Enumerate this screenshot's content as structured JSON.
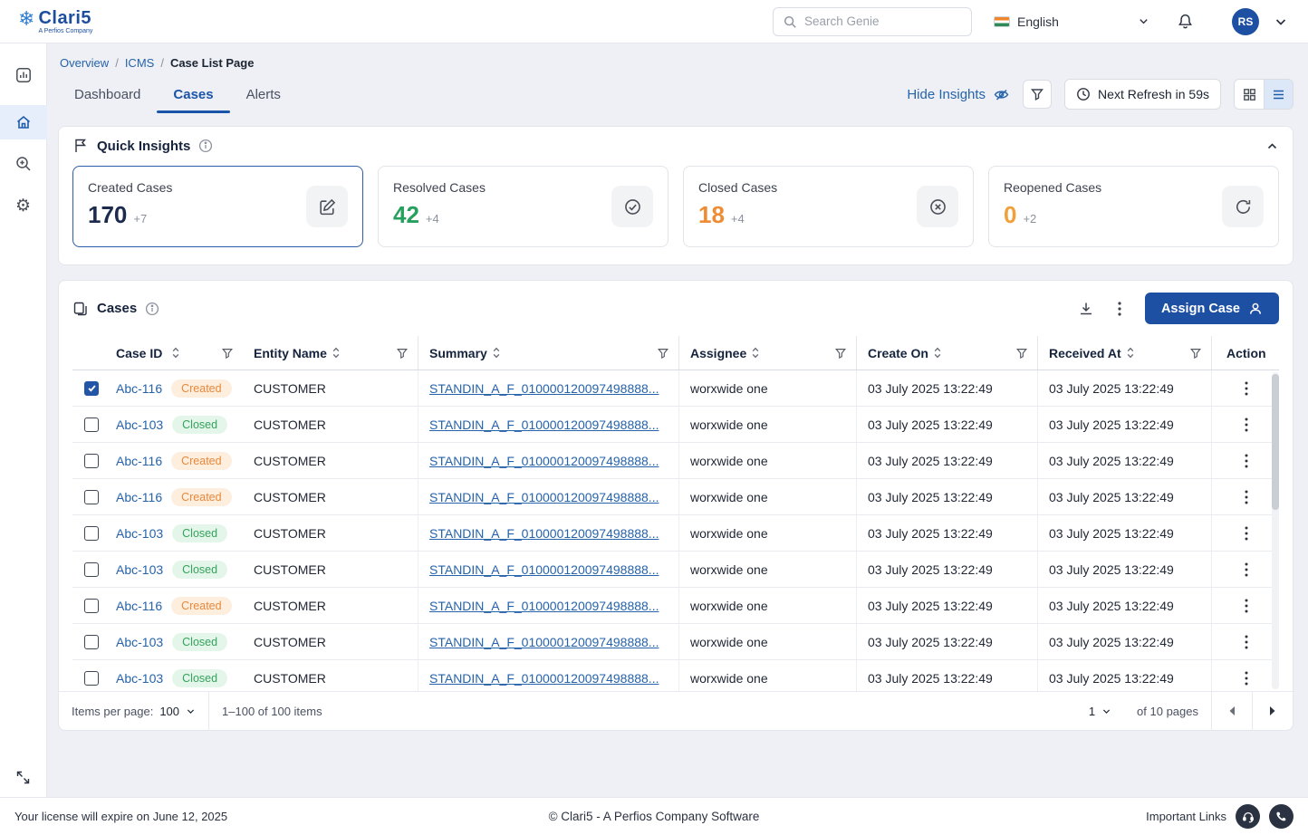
{
  "header": {
    "brand": "Clari5",
    "brand_subtitle": "A Perfios Company",
    "search_placeholder": "Search Genie",
    "language": "English",
    "avatar_initials": "RS"
  },
  "breadcrumb": {
    "overview": "Overview",
    "icms": "ICMS",
    "current": "Case List Page",
    "separator": "/"
  },
  "tabs": {
    "dashboard": "Dashboard",
    "cases": "Cases",
    "alerts": "Alerts"
  },
  "toolbar": {
    "hide_insights": "Hide Insights",
    "next_refresh": "Next Refresh in 59s"
  },
  "icons": {
    "snowflake": "❄",
    "gear": "⚙"
  },
  "colors": {
    "primary_blue": "#1d4fa3",
    "link_blue": "#2563ab",
    "created_badge_text": "#e8883b",
    "created_badge_bg": "#fdeedd",
    "closed_badge_text": "#33a35c",
    "closed_badge_bg": "#e4f6ea"
  },
  "quick_insights": {
    "title": "Quick Insights",
    "cards": [
      {
        "label": "Created Cases",
        "value": "170",
        "delta": "+7",
        "value_color": "#1c2b4d"
      },
      {
        "label": "Resolved Cases",
        "value": "42",
        "delta": "+4",
        "value_color": "#27a05e"
      },
      {
        "label": "Closed Cases",
        "value": "18",
        "delta": "+4",
        "value_color": "#ef8c33"
      },
      {
        "label": "Reopened Cases",
        "value": "0",
        "delta": "+2",
        "value_color": "#f0a139"
      }
    ]
  },
  "cases": {
    "title": "Cases",
    "assign_button": "Assign Case",
    "columns": [
      "Case ID",
      "Entity Name",
      "Summary",
      "Assignee",
      "Create On",
      "Received At",
      "Action"
    ],
    "rows": [
      {
        "checked": true,
        "case_id": "Abc-116",
        "status": "Created",
        "entity": "CUSTOMER",
        "summary": "STANDIN_A_F_010000120097498888...",
        "assignee": "worxwide one",
        "create_on": "03 July 2025 13:22:49",
        "received_at": "03 July 2025 13:22:49"
      },
      {
        "checked": false,
        "case_id": "Abc-103",
        "status": "Closed",
        "entity": "CUSTOMER",
        "summary": "STANDIN_A_F_010000120097498888...",
        "assignee": "worxwide one",
        "create_on": "03 July 2025 13:22:49",
        "received_at": "03 July 2025 13:22:49"
      },
      {
        "checked": false,
        "case_id": "Abc-116",
        "status": "Created",
        "entity": "CUSTOMER",
        "summary": "STANDIN_A_F_010000120097498888...",
        "assignee": "worxwide one",
        "create_on": "03 July 2025 13:22:49",
        "received_at": "03 July 2025 13:22:49"
      },
      {
        "checked": false,
        "case_id": "Abc-116",
        "status": "Created",
        "entity": "CUSTOMER",
        "summary": "STANDIN_A_F_010000120097498888...",
        "assignee": "worxwide one",
        "create_on": "03 July 2025 13:22:49",
        "received_at": "03 July 2025 13:22:49"
      },
      {
        "checked": false,
        "case_id": "Abc-103",
        "status": "Closed",
        "entity": "CUSTOMER",
        "summary": "STANDIN_A_F_010000120097498888...",
        "assignee": "worxwide one",
        "create_on": "03 July 2025 13:22:49",
        "received_at": "03 July 2025 13:22:49"
      },
      {
        "checked": false,
        "case_id": "Abc-103",
        "status": "Closed",
        "entity": "CUSTOMER",
        "summary": "STANDIN_A_F_010000120097498888...",
        "assignee": "worxwide one",
        "create_on": "03 July 2025 13:22:49",
        "received_at": "03 July 2025 13:22:49"
      },
      {
        "checked": false,
        "case_id": "Abc-116",
        "status": "Created",
        "entity": "CUSTOMER",
        "summary": "STANDIN_A_F_010000120097498888...",
        "assignee": "worxwide one",
        "create_on": "03 July 2025 13:22:49",
        "received_at": "03 July 2025 13:22:49"
      },
      {
        "checked": false,
        "case_id": "Abc-103",
        "status": "Closed",
        "entity": "CUSTOMER",
        "summary": "STANDIN_A_F_010000120097498888...",
        "assignee": "worxwide one",
        "create_on": "03 July 2025 13:22:49",
        "received_at": "03 July 2025 13:22:49"
      },
      {
        "checked": false,
        "case_id": "Abc-103",
        "status": "Closed",
        "entity": "CUSTOMER",
        "summary": "STANDIN_A_F_010000120097498888...",
        "assignee": "worxwide one",
        "create_on": "03 July 2025 13:22:49",
        "received_at": "03 July 2025 13:22:49"
      }
    ],
    "pagination": {
      "items_per_page_label": "Items per page:",
      "items_per_page": "100",
      "range_text": "1–100 of 100 items",
      "page": "1",
      "pages_text": "of 10 pages"
    }
  },
  "footer": {
    "license_text": "Your license will expire on June 12, 2025",
    "copyright": "© Clari5 - A Perfios Company Software",
    "important_links": "Important Links"
  }
}
